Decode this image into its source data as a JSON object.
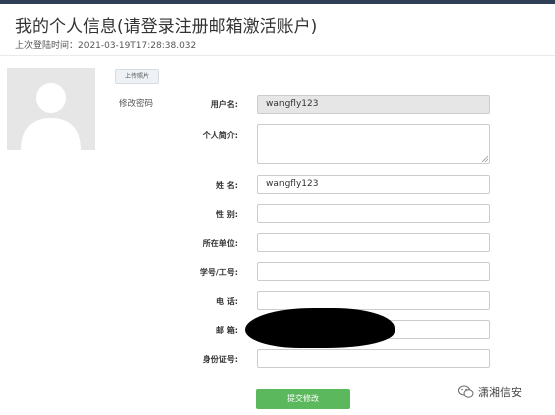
{
  "page": {
    "title": "我的个人信息(请登录注册邮箱激活账户)",
    "last_login": "上次登陆时间：2021-03-19T17:28:38.032"
  },
  "profile": {
    "upload_photo_label": "上传照片",
    "change_password_label": "修改密码"
  },
  "form": {
    "username": {
      "label": "用户名:",
      "value": "wangfly123"
    },
    "bio": {
      "label": "个人简介:",
      "value": ""
    },
    "name": {
      "label": "姓 名:",
      "value": "wangfly123"
    },
    "gender": {
      "label": "性 别:",
      "value": ""
    },
    "org": {
      "label": "所在单位:",
      "value": ""
    },
    "student_id": {
      "label": "学号/工号:",
      "value": ""
    },
    "phone": {
      "label": "电 话:",
      "value": ""
    },
    "email": {
      "label": "邮 箱:",
      "value": ""
    },
    "id_number": {
      "label": "身份证号:",
      "value": ""
    },
    "submit_label": "提交修改"
  },
  "watermark": {
    "text": "潇湘信安",
    "icon": "wechat-icon"
  },
  "colors": {
    "topbar": "#2f3d55",
    "submit": "#5cb85c",
    "readonly_bg": "#e6e6e6"
  }
}
